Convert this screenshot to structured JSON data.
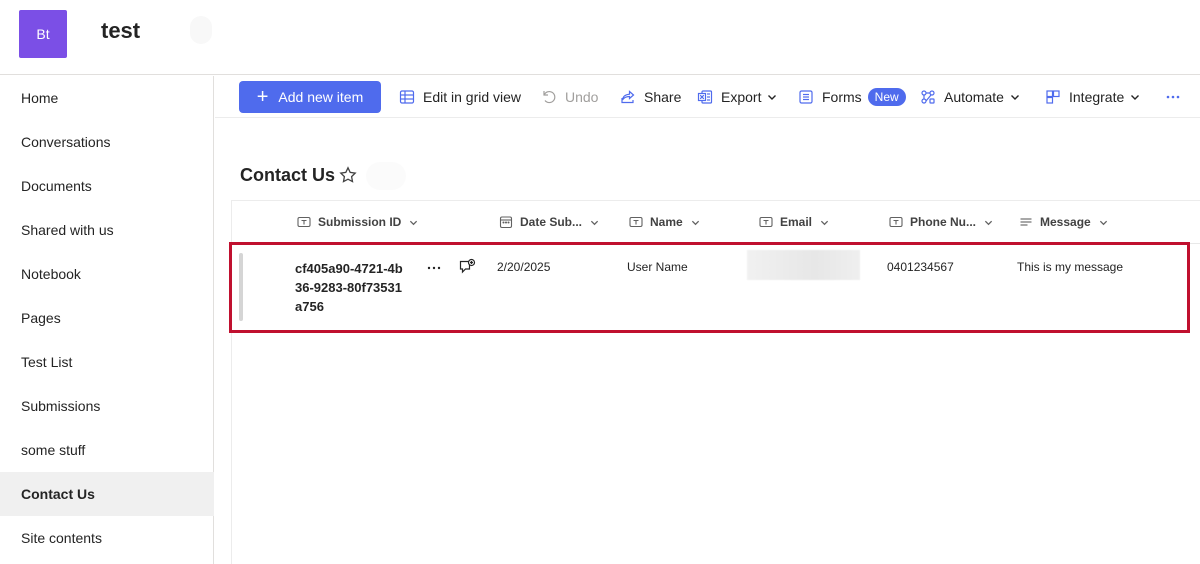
{
  "site": {
    "logo_initials": "Bt",
    "title": "test"
  },
  "nav": {
    "items": [
      {
        "label": "Home"
      },
      {
        "label": "Conversations"
      },
      {
        "label": "Documents"
      },
      {
        "label": "Shared with us"
      },
      {
        "label": "Notebook"
      },
      {
        "label": "Pages"
      },
      {
        "label": "Test List"
      },
      {
        "label": "Submissions"
      },
      {
        "label": "some stuff"
      },
      {
        "label": "Contact Us",
        "active": true
      },
      {
        "label": "Site contents"
      }
    ]
  },
  "toolbar": {
    "add_label": "Add new item",
    "grid_label": "Edit in grid view",
    "undo_label": "Undo",
    "share_label": "Share",
    "export_label": "Export",
    "forms_label": "Forms",
    "forms_badge": "New",
    "automate_label": "Automate",
    "integrate_label": "Integrate"
  },
  "list": {
    "title": "Contact Us",
    "columns": {
      "submission_id": "Submission ID",
      "date": "Date Sub...",
      "name": "Name",
      "email": "Email",
      "phone": "Phone Nu...",
      "message": "Message"
    },
    "row": {
      "submission_id": "cf405a90-4721-4b36-9283-80f73531a756",
      "date": "2/20/2025",
      "name": "User Name",
      "email": "",
      "phone": "0401234567",
      "message": "This is my message"
    }
  },
  "colors": {
    "accent": "#4f6bed",
    "logo": "#7b4fe6",
    "highlight": "#c0102f"
  }
}
